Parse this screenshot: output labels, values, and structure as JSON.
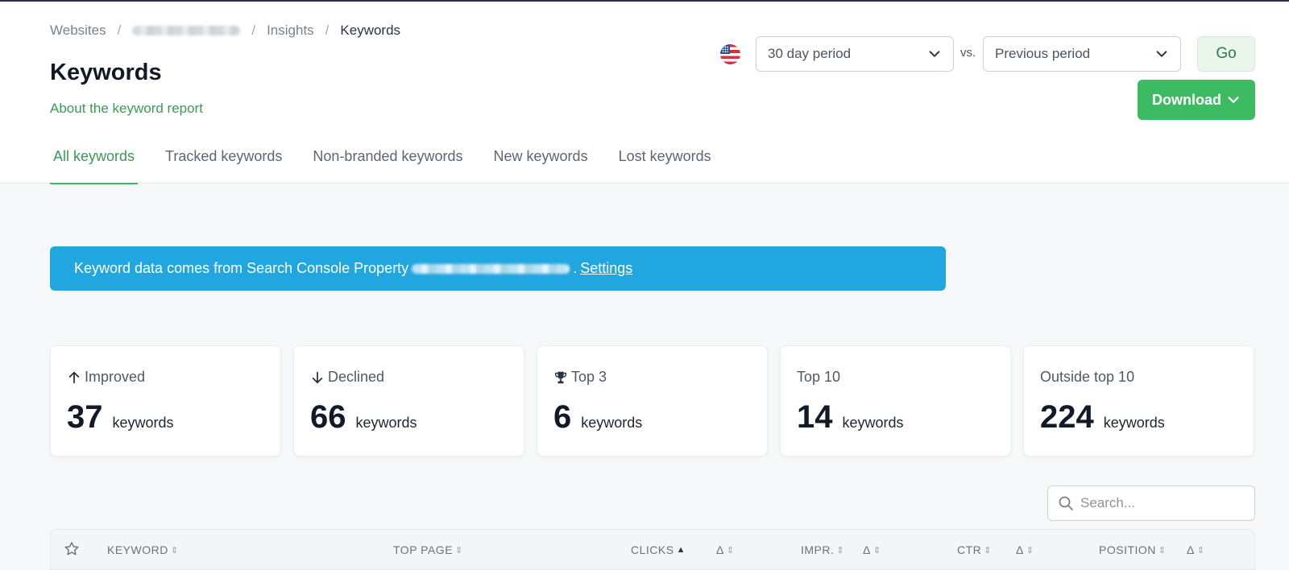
{
  "breadcrumb": {
    "items": [
      "Websites",
      "",
      "Insights",
      "Keywords"
    ],
    "separator": "/"
  },
  "page": {
    "title": "Keywords",
    "about_link": "About the keyword report"
  },
  "controls": {
    "period_value": "30 day period",
    "vs_label": "vs.",
    "compare_value": "Previous period",
    "go_label": "Go",
    "download_label": "Download"
  },
  "tabs": [
    {
      "label": "All keywords",
      "active": true
    },
    {
      "label": "Tracked keywords",
      "active": false
    },
    {
      "label": "Non-branded keywords",
      "active": false
    },
    {
      "label": "New keywords",
      "active": false
    },
    {
      "label": "Lost keywords",
      "active": false
    }
  ],
  "banner": {
    "text": "Keyword data comes from Search Console Property",
    "settings_link": "Settings"
  },
  "cards": [
    {
      "label": "Improved",
      "icon": "arrow-up-icon",
      "value": "37",
      "unit": "keywords"
    },
    {
      "label": "Declined",
      "icon": "arrow-down-icon",
      "value": "66",
      "unit": "keywords"
    },
    {
      "label": "Top 3",
      "icon": "trophy-icon",
      "value": "6",
      "unit": "keywords"
    },
    {
      "label": "Top 10",
      "icon": "",
      "value": "14",
      "unit": "keywords"
    },
    {
      "label": "Outside top 10",
      "icon": "",
      "value": "224",
      "unit": "keywords"
    }
  ],
  "search": {
    "placeholder": "Search..."
  },
  "table": {
    "columns": [
      "KEYWORD",
      "TOP PAGE",
      "CLICKS",
      "Δ",
      "IMPR.",
      "Δ",
      "CTR",
      "Δ",
      "POSITION",
      "Δ"
    ],
    "sort_column": "CLICKS",
    "sort_direction": "asc"
  },
  "colors": {
    "accent_green": "#3dbb63",
    "banner_blue": "#22a6df",
    "link_green": "#3a9a55"
  }
}
